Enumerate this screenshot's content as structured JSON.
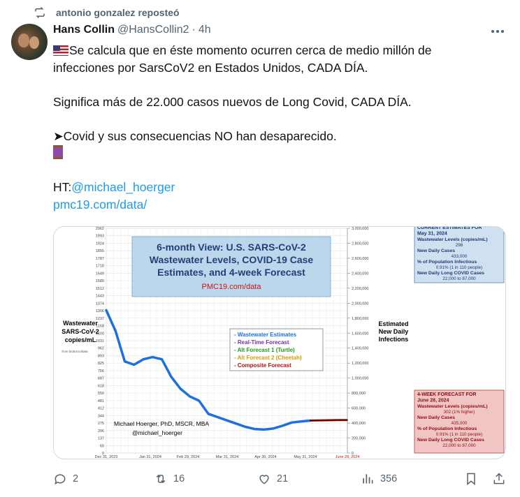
{
  "repost": {
    "text": "antonio gonzalez reposteó"
  },
  "author": {
    "name": "Hans Collin",
    "handle": "@HansCollin2",
    "sep": "·",
    "time": "4h"
  },
  "tweet": {
    "line1": "Se calcula que en éste momento ocurren cerca de medio millón de",
    "line2": "infecciones por SarsCoV2 en Estados Unidos, CADA DÍA.",
    "line3": "Significa más de 22.000 casos nuevos de Long Covid, CADA DÍA.",
    "line4": "➤Covid y sus consecuencias NO han desaparecido.",
    "ht_prefix": "HT:",
    "ht_link": "@michael_hoerger",
    "url": "pmc19.com/data/"
  },
  "chart": {
    "title_lines": [
      "6-month View: U.S. SARS-CoV-2",
      "Wastewater Levels, COVID-19 Case",
      "Estimates, and 4-week Forecast"
    ],
    "title_url": "PMC19.com/data",
    "left_label": [
      "Wastewater",
      "SARS-CoV-2",
      "copies/mL"
    ],
    "left_source": "from biobot.io/data",
    "right_label": [
      "Estimated",
      "New Daily",
      "Infections"
    ],
    "author_lines": [
      "Michael Hoerger, PhD, MSCR, MBA",
      "@michael_hoerger"
    ],
    "left_ticks": [
      "2062",
      "1993",
      "1924",
      "1855",
      "1787",
      "1718",
      "1649",
      "1580",
      "1512",
      "1443",
      "1374",
      "1306",
      "1237",
      "1168",
      "1100",
      "1031",
      "962",
      "893",
      "825",
      "756",
      "687",
      "618",
      "550",
      "481",
      "412",
      "344",
      "275",
      "206",
      "137",
      "69",
      "0"
    ],
    "right_ticks": [
      "3,000,000",
      "2,800,000",
      "2,600,000",
      "2,400,000",
      "2,200,000",
      "2,000,000",
      "1,800,000",
      "1,600,000",
      "1,400,000",
      "1,200,000",
      "1,000,000",
      "800,000",
      "600,000",
      "400,000",
      "200,000",
      "0"
    ],
    "x_ticks": [
      "Dec 31, 2023",
      "Jan 31, 2024",
      "Feb 29, 2024",
      "Mar 31, 2024",
      "Apr 30, 2024",
      "May 31, 2024",
      "June 28, 2024"
    ],
    "legend": [
      {
        "label": "- Wastewater Estimates",
        "color": "#1e6fe0"
      },
      {
        "label": "- Real-Time Forecast",
        "color": "#7b2fa8"
      },
      {
        "label": "- Alt Forecast 1 (Turtle)",
        "color": "#1c9c1c"
      },
      {
        "label": "- Alt Forecast 2 (Cheetah)",
        "color": "#d79a00"
      },
      {
        "label": "- Composite Forecast",
        "color": "#b01515"
      }
    ],
    "current_box": {
      "title": [
        "CURRENT ESTIMATES FOR",
        "May 31, 2024"
      ],
      "lines": [
        "Wastewater Levels (copies/mL)",
        "298",
        "New Daily Cases",
        "433,000",
        "% of Population Infectious",
        "0.91% (1 in 110 people)",
        "New Daily Long COVID Cases",
        "22,000 to 87,000"
      ]
    },
    "forecast_box": {
      "title": [
        "4-WEEK FORECAST FOR",
        "June 28, 2024"
      ],
      "lines": [
        "Wastewater Levels (copies/mL)",
        "302 (1% higher)",
        "New Daily Cases",
        "435,000",
        "% of Population Infectious",
        "0.91% (1 in 110 people)",
        "New Daily Long COVID Cases",
        "22,000 to 87,000"
      ]
    }
  },
  "chart_data": {
    "type": "line",
    "title": "6-month View: U.S. SARS-CoV-2 Wastewater Levels, COVID-19 Case Estimates, and 4-week Forecast",
    "ylabel": "Wastewater SARS-CoV-2 copies/mL",
    "y2label": "Estimated New Daily Infections",
    "ylim": [
      0,
      2062
    ],
    "y2lim": [
      0,
      3000000
    ],
    "x": [
      "Dec 31, 2023",
      "Jan 7, 2024",
      "Jan 14, 2024",
      "Jan 21, 2024",
      "Jan 28, 2024",
      "Feb 4, 2024",
      "Feb 11, 2024",
      "Feb 18, 2024",
      "Feb 25, 2024",
      "Mar 3, 2024",
      "Mar 10, 2024",
      "Mar 17, 2024",
      "Mar 24, 2024",
      "Mar 31, 2024",
      "Apr 7, 2024",
      "Apr 14, 2024",
      "Apr 21, 2024",
      "Apr 28, 2024",
      "May 5, 2024",
      "May 12, 2024",
      "May 19, 2024",
      "May 26, 2024",
      "May 31, 2024",
      "June 7, 2024",
      "June 14, 2024",
      "June 21, 2024",
      "June 28, 2024"
    ],
    "series": [
      {
        "name": "Wastewater Estimates",
        "values": [
          1310,
          1120,
          840,
          810,
          860,
          880,
          860,
          700,
          590,
          520,
          480,
          360,
          330,
          300,
          270,
          240,
          220,
          215,
          225,
          250,
          280,
          290,
          298,
          null,
          null,
          null,
          null
        ]
      },
      {
        "name": "Composite Forecast",
        "values": [
          null,
          null,
          null,
          null,
          null,
          null,
          null,
          null,
          null,
          null,
          null,
          null,
          null,
          null,
          null,
          null,
          null,
          null,
          null,
          null,
          null,
          null,
          298,
          300,
          301,
          302,
          302
        ]
      }
    ],
    "x_tick_labels": [
      "Dec 31, 2023",
      "Jan 31, 2024",
      "Feb 29, 2024",
      "Mar 31, 2024",
      "Apr 30, 2024",
      "May 31, 2024",
      "June 28, 2024"
    ]
  },
  "actions": {
    "reply_count": "2",
    "repost_count": "16",
    "like_count": "21",
    "view_count": "356"
  }
}
